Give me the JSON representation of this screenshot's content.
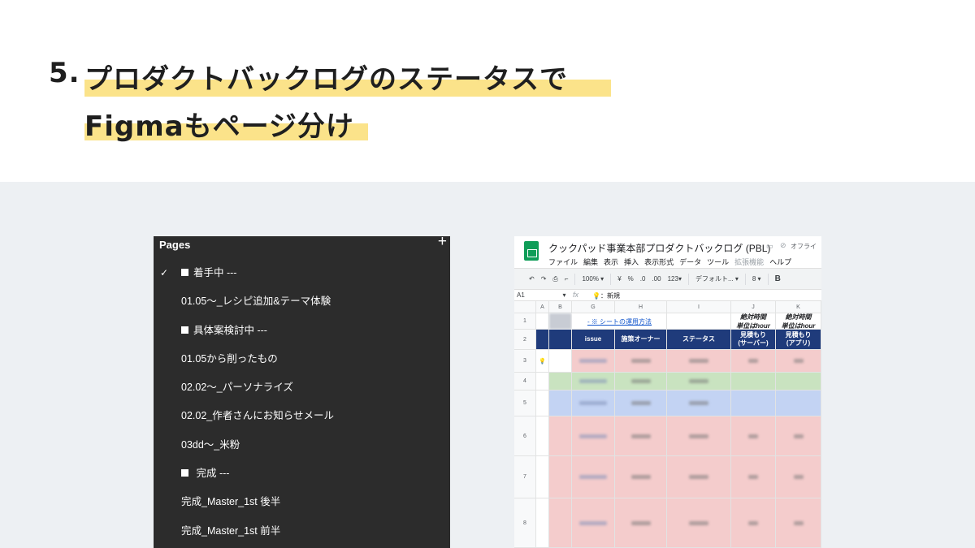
{
  "slide": {
    "number": "5.",
    "title_line1": "プロダクトバックログのステータスで",
    "title_line2": "Figmaもページ分け"
  },
  "figma": {
    "panel_title": "Pages",
    "add_icon": "plus-icon",
    "pages": [
      {
        "label": "着手中 ---",
        "checked": true,
        "square": true
      },
      {
        "label": "01.05〜_レシピ追加&テーマ体験",
        "checked": false,
        "square": false
      },
      {
        "label": "具体案検討中 ---",
        "checked": false,
        "square": true
      },
      {
        "label": "01.05から削ったもの",
        "checked": false,
        "square": false
      },
      {
        "label": "02.02〜_パーソナライズ",
        "checked": false,
        "square": false
      },
      {
        "label": "02.02_作者さんにお知らせメール",
        "checked": false,
        "square": false
      },
      {
        "label": "03dd〜_米粉",
        "checked": false,
        "square": false
      },
      {
        "label": " 完成 ---",
        "checked": false,
        "square": true
      },
      {
        "label": "完成_Master_1st 後半",
        "checked": false,
        "square": false
      },
      {
        "label": "完成_Master_1st 前半",
        "checked": false,
        "square": false
      }
    ]
  },
  "sheets": {
    "doc_title": "クックパッド事業本部プロダクトバックログ (PBL)",
    "offline_label": "オフライ",
    "menu": [
      "ファイル",
      "編集",
      "表示",
      "挿入",
      "表示形式",
      "データ",
      "ツール",
      "拡張機能",
      "ヘルプ"
    ],
    "toolbar": {
      "zoom": "100%",
      "currency": "¥",
      "percent": "%",
      "dec_decrease": ".0",
      "dec_increase": ".00",
      "number_format": "123",
      "font": "デフォルト...",
      "font_size": "8",
      "bold": "B"
    },
    "cell_ref": "A1",
    "fx": "fx",
    "formula_value": "💡：新規",
    "columns": [
      "A",
      "B",
      "G",
      "H",
      "I",
      "J",
      "K"
    ],
    "rows": [
      "1",
      "2",
      "3",
      "4",
      "5",
      "6",
      "7",
      "8"
    ],
    "link_text": "- ※ シートの運用方法",
    "note_j": "絶対時間\n単位はhour",
    "note_k": "絶対時間\n単位はhour",
    "headers": {
      "issue": "issue",
      "owner": "施策オーナー",
      "status": "ステータス",
      "est_server": "見積もり\n(サーバー)",
      "est_app": "見積もり\n(アプリ)"
    },
    "row3_bulb": "💡",
    "row_colors": {
      "red": "#f4cccc",
      "green": "#c9e3c0",
      "blue": "#c3d3f3",
      "header_blue": "#1f3b7b"
    }
  }
}
